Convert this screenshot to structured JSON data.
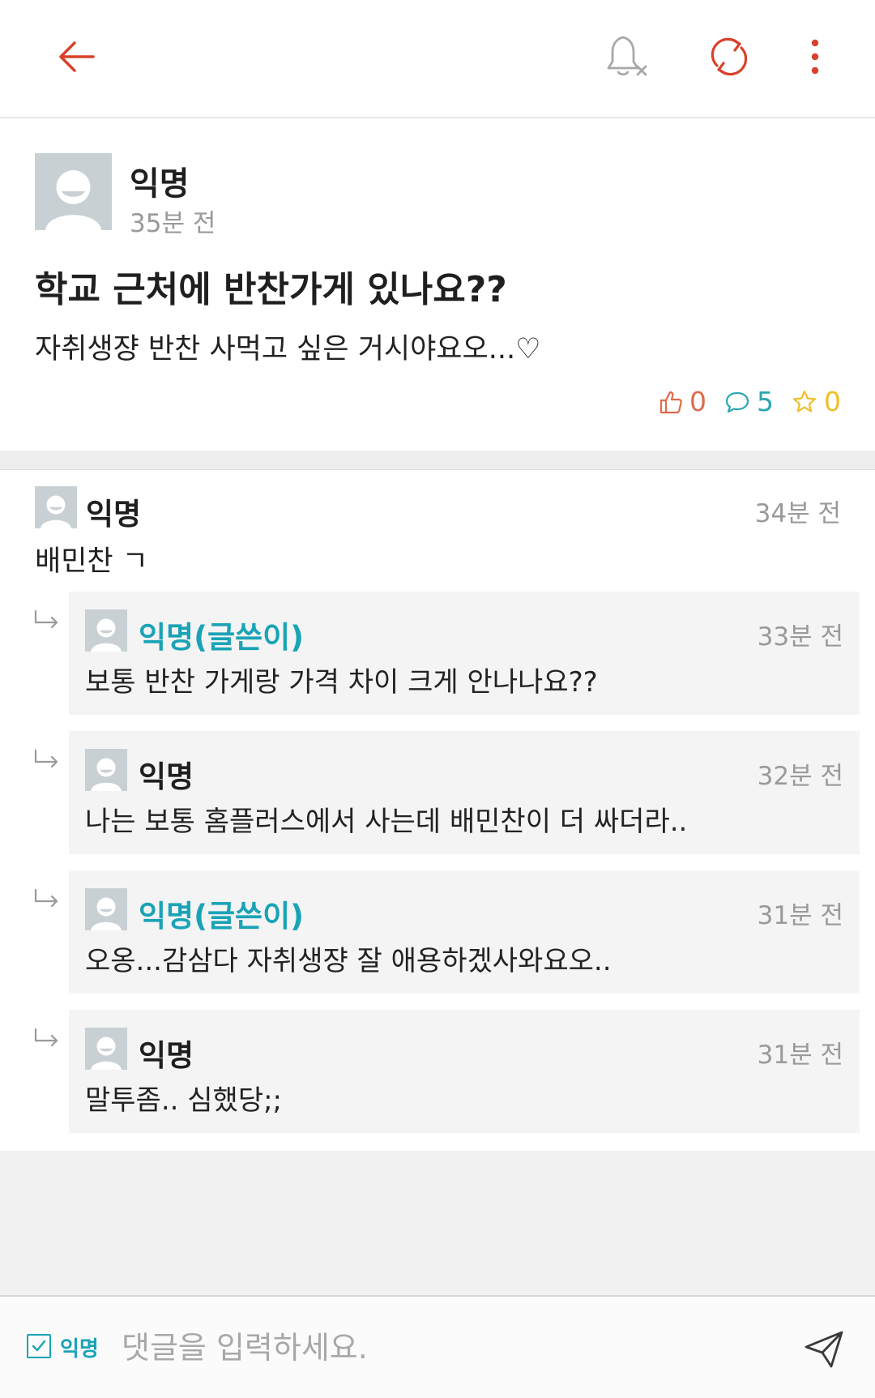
{
  "colors": {
    "accent": "#d9412b",
    "op_name": "#1aa3b6",
    "like": "#e06a4a",
    "comment": "#2aa6b3",
    "star": "#efbf2a"
  },
  "header": {
    "icons": [
      "back-arrow-icon",
      "bell-off-icon",
      "refresh-icon",
      "more-vertical-icon"
    ]
  },
  "post": {
    "author": "익명",
    "time": "35분 전",
    "title": "학교 근처에 반찬가게 있나요??",
    "body": "자취생쟝 반찬 사먹고 싶은 거시야요오...♡",
    "likes": "0",
    "comments": "5",
    "scraps": "0"
  },
  "comment": {
    "author": "익명",
    "time": "34분 전",
    "text": "배민찬 ㄱ"
  },
  "replies": [
    {
      "author": "익명(글쓴이)",
      "time": "33분 전",
      "text": "보통 반찬 가게랑 가격 차이 크게 안나나요??",
      "is_op": true
    },
    {
      "author": "익명",
      "time": "32분 전",
      "text": "나는 보통 홈플러스에서 사는데 배민찬이 더 싸더라..",
      "is_op": false
    },
    {
      "author": "익명(글쓴이)",
      "time": "31분 전",
      "text": "오옹...감삼다 자취생쟝 잘 애용하겠사와요오..",
      "is_op": true
    },
    {
      "author": "익명",
      "time": "31분 전",
      "text": "말투좀.. 심했당;;",
      "is_op": false
    }
  ],
  "input": {
    "anonymous_label": "익명",
    "anonymous_checked": true,
    "placeholder": "댓글을 입력하세요."
  }
}
